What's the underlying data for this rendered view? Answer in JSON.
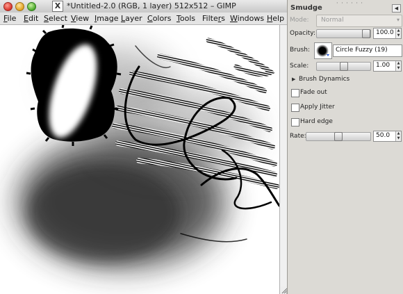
{
  "window": {
    "title": "*Untitled-2.0 (RGB, 1 layer) 512x512 – GIMP",
    "x11_glyph": "X"
  },
  "menubar": [
    {
      "id": "file",
      "label": "File",
      "mn": "F",
      "rest": "ile"
    },
    {
      "id": "edit",
      "label": "Edit",
      "mn": "E",
      "rest": "dit"
    },
    {
      "id": "select",
      "label": "Select",
      "mn": "S",
      "rest": "elect"
    },
    {
      "id": "view",
      "label": "View",
      "mn": "V",
      "rest": "iew"
    },
    {
      "id": "image",
      "label": "Image",
      "mn": "I",
      "rest": "mage"
    },
    {
      "id": "layer",
      "label": "Layer",
      "mn": "L",
      "rest": "ayer"
    },
    {
      "id": "colors",
      "label": "Colors",
      "mn": "C",
      "rest": "olors"
    },
    {
      "id": "tools",
      "label": "Tools",
      "mn": "T",
      "rest": "ools"
    },
    {
      "id": "filters",
      "label": "Filters",
      "mn": "r",
      "pre": "Filte",
      "rest": "s"
    },
    {
      "id": "windows",
      "label": "Windows",
      "mn": "W",
      "rest": "indows"
    },
    {
      "id": "help",
      "label": "Help",
      "mn": "H",
      "rest": "elp"
    }
  ],
  "dock": {
    "grip": "· · · · · ·",
    "title": "Smudge",
    "menu_icon": "left-arrow-icon",
    "mode_label": "Mode:",
    "mode_value": "Normal",
    "opacity_label": "Opacity:",
    "opacity_value": "100.0",
    "opacity_fraction": 1.0,
    "brush_label": "Brush:",
    "brush_name": "Circle Fuzzy (19)",
    "scale_label": "Scale:",
    "scale_value": "1.00",
    "scale_fraction": 0.5,
    "brush_dynamics_label": "Brush Dynamics",
    "fade_out_label": "Fade out",
    "fade_out_checked": false,
    "apply_jitter_label": "Apply Jitter",
    "apply_jitter_checked": false,
    "hard_edge_label": "Hard edge",
    "hard_edge_checked": false,
    "rate_label": "Rate:",
    "rate_value": "50.0",
    "rate_fraction": 0.5
  },
  "colors": {
    "dock_bg": "#dcdad5",
    "canvas_bg": "#ffffff",
    "paint": "#000000"
  }
}
